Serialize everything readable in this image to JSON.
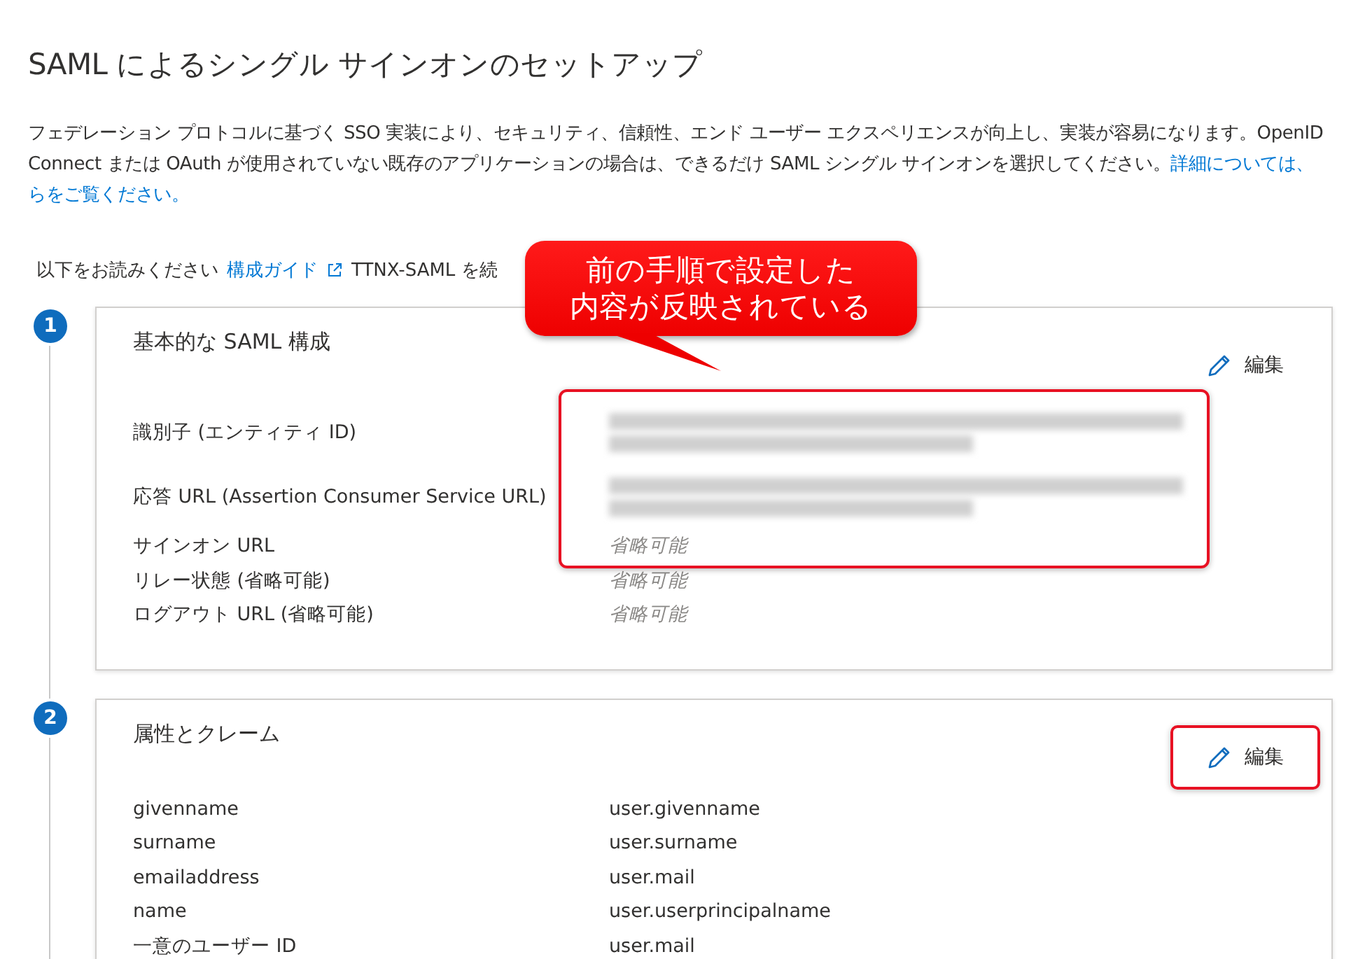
{
  "title": "SAML によるシングル サインオンのセットアップ",
  "description": {
    "text": "フェデレーション プロトコルに基づく SSO 実装により、セキュリティ、信頼性、エンド ユーザー エクスペリエンスが向上し、実装が容易になります。OpenID Connect または OAuth が使用されていない既存のアプリケーションの場合は、できるだけ SAML シングル サインオンを選択してください。",
    "links": [
      "詳細については、",
      "らをご覧ください。"
    ]
  },
  "guide": {
    "prefix": "以下をお読みください",
    "link": "構成ガイド",
    "suffix": "TTNX-SAML を続"
  },
  "steps": [
    {
      "number": "1",
      "title": "基本的な SAML 構成",
      "edit_label": "編集",
      "edit_highlighted": false,
      "values_highlighted": true,
      "rows": [
        {
          "label": "識別子 (エンティティ ID)",
          "kind": "redacted"
        },
        {
          "label": "応答 URL (Assertion Consumer Service URL)",
          "kind": "redacted"
        },
        {
          "label": "サインオン URL",
          "kind": "optional",
          "value": "省略可能"
        },
        {
          "label": "リレー状態 (省略可能)",
          "kind": "optional",
          "value": "省略可能"
        },
        {
          "label": "ログアウト URL (省略可能)",
          "kind": "optional",
          "value": "省略可能"
        }
      ]
    },
    {
      "number": "2",
      "title": "属性とクレーム",
      "edit_label": "編集",
      "edit_highlighted": true,
      "rows": [
        {
          "label": "givenname",
          "kind": "text",
          "value": "user.givenname"
        },
        {
          "label": "surname",
          "kind": "text",
          "value": "user.surname"
        },
        {
          "label": "emailaddress",
          "kind": "text",
          "value": "user.mail"
        },
        {
          "label": "name",
          "kind": "text",
          "value": "user.userprincipalname"
        },
        {
          "label": "一意のユーザー ID",
          "kind": "text",
          "value": "user.mail"
        }
      ]
    }
  ],
  "callout": {
    "lines": [
      "前の手順で設定した",
      "内容が反映されている"
    ]
  }
}
